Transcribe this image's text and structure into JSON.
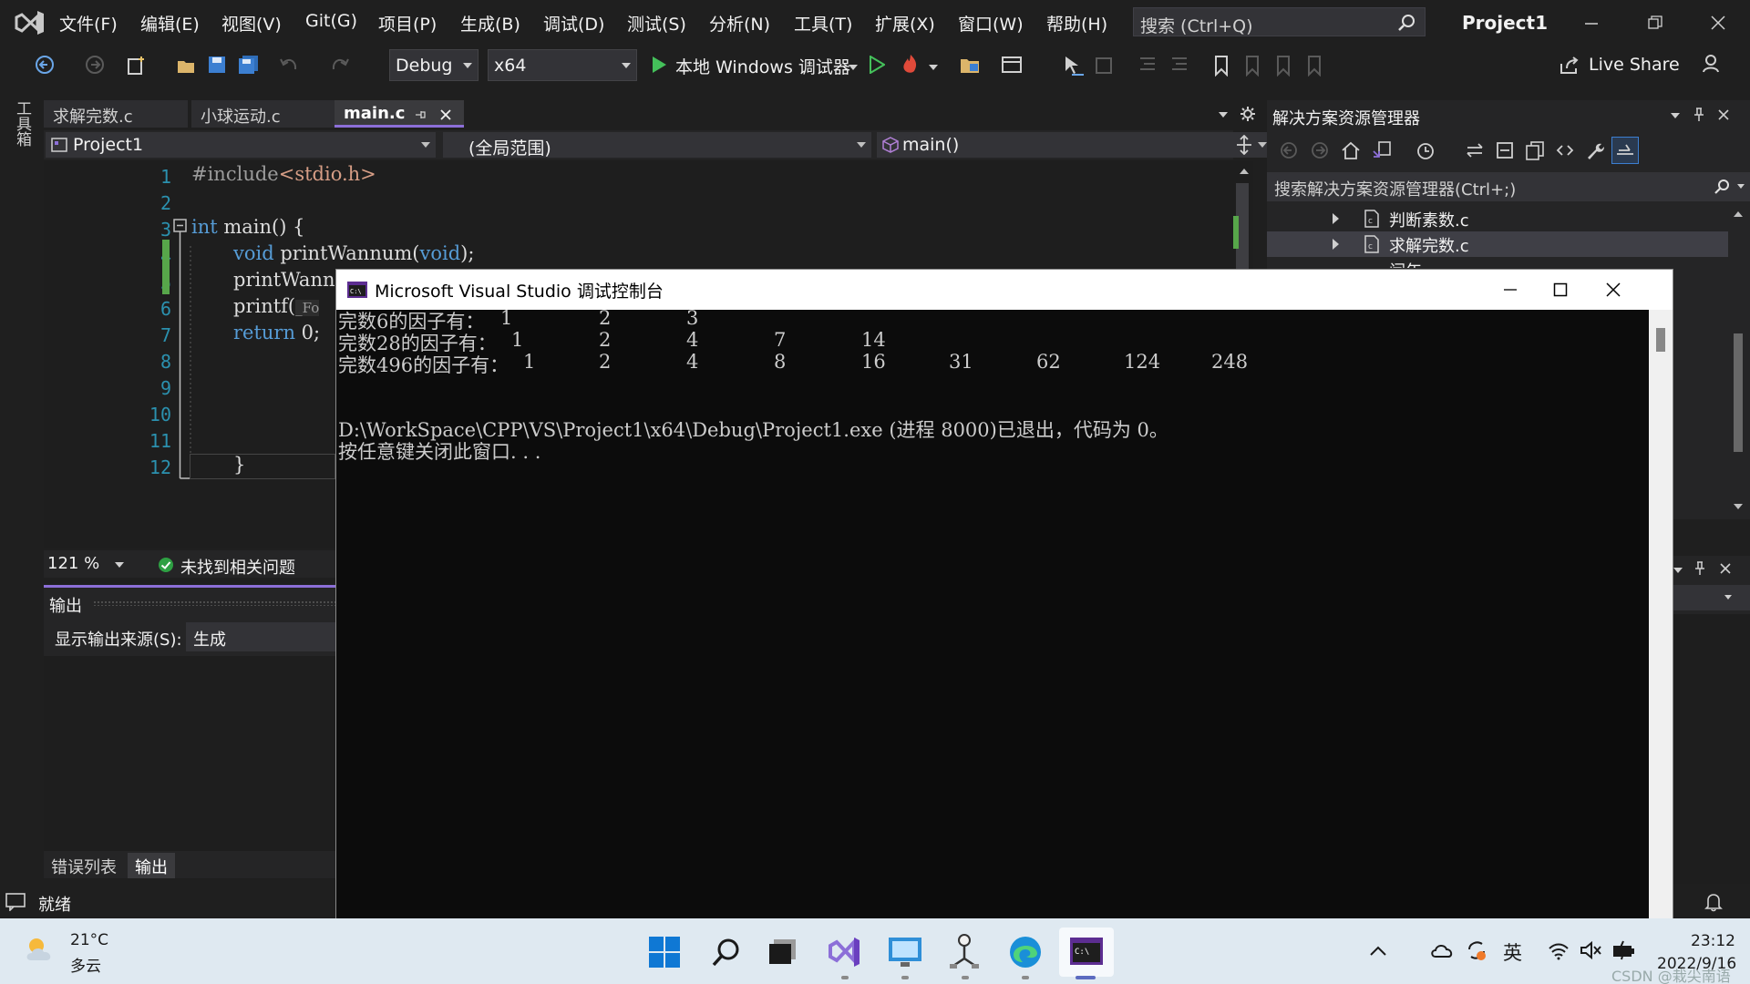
{
  "menu": {
    "items": [
      "文件(F)",
      "编辑(E)",
      "视图(V)",
      "Git(G)",
      "项目(P)",
      "生成(B)",
      "调试(D)",
      "测试(S)",
      "分析(N)",
      "工具(T)",
      "扩展(X)",
      "窗口(W)",
      "帮助(H)"
    ],
    "search_placeholder": "搜索 (Ctrl+Q)",
    "project_name": "Project1"
  },
  "toolbar": {
    "config": "Debug",
    "platform": "x64",
    "run_label": "本地 Windows 调试器",
    "live_share": "Live Share"
  },
  "toolbox_label": "工具箱",
  "editor": {
    "tabs": [
      "求解完数.c",
      "小球运动.c",
      "main.c"
    ],
    "active_tab": "main.c",
    "nav_project": "Project1",
    "nav_scope": "(全局范围)",
    "nav_member": "main()",
    "line_numbers": [
      "1",
      "2",
      "3",
      "4",
      "5",
      "6",
      "7",
      "8",
      "9",
      "10",
      "11",
      "12"
    ],
    "code": {
      "l1_pre": "#include",
      "l1_hdr": "<stdio.h>",
      "l3_kw": "int",
      "l3_rest": " main() {",
      "l4_kw": "void",
      "l4_rest": " printWannum(",
      "l4_kw2": "void",
      "l4_end": ");",
      "l5": "printWannu",
      "l6": "printf(",
      "l6_hint": "_Fo",
      "l7_kw": "return",
      "l7_rest": " 0;",
      "l12": "}"
    },
    "zoom": "121 %",
    "issues": "未找到相关问题"
  },
  "output": {
    "title": "输出",
    "source_label": "显示输出来源(S):",
    "source_value": "生成",
    "tabs": [
      "错误列表",
      "输出"
    ]
  },
  "solution_explorer": {
    "title": "解决方案资源管理器",
    "search_placeholder": "搜索解决方案资源管理器(Ctrl+;)",
    "items": [
      "判断素数.c",
      "求解完数.c",
      "闰年.c"
    ]
  },
  "status": "就绪",
  "console": {
    "title": "Microsoft Visual Studio 调试控制台",
    "rows": [
      {
        "label": "完数6的因子有：",
        "values": [
          "1",
          "2",
          "3"
        ]
      },
      {
        "label": "完数28的因子有：",
        "values": [
          "1",
          "2",
          "4",
          "7",
          "14"
        ]
      },
      {
        "label": "完数496的因子有：",
        "values": [
          "1",
          "2",
          "4",
          "8",
          "16",
          "31",
          "62",
          "124",
          "248"
        ]
      }
    ],
    "exit_line": "D:\\WorkSpace\\CPP\\VS\\Project1\\x64\\Debug\\Project1.exe (进程 8000)已退出，代码为 0。",
    "press_key_line": "按任意键关闭此窗口. . ."
  },
  "taskbar": {
    "temperature": "21°C",
    "weather": "多云",
    "ime": "英",
    "time": "23:12",
    "date": "2022/9/16",
    "watermark": "CSDN @栽尖南语"
  }
}
